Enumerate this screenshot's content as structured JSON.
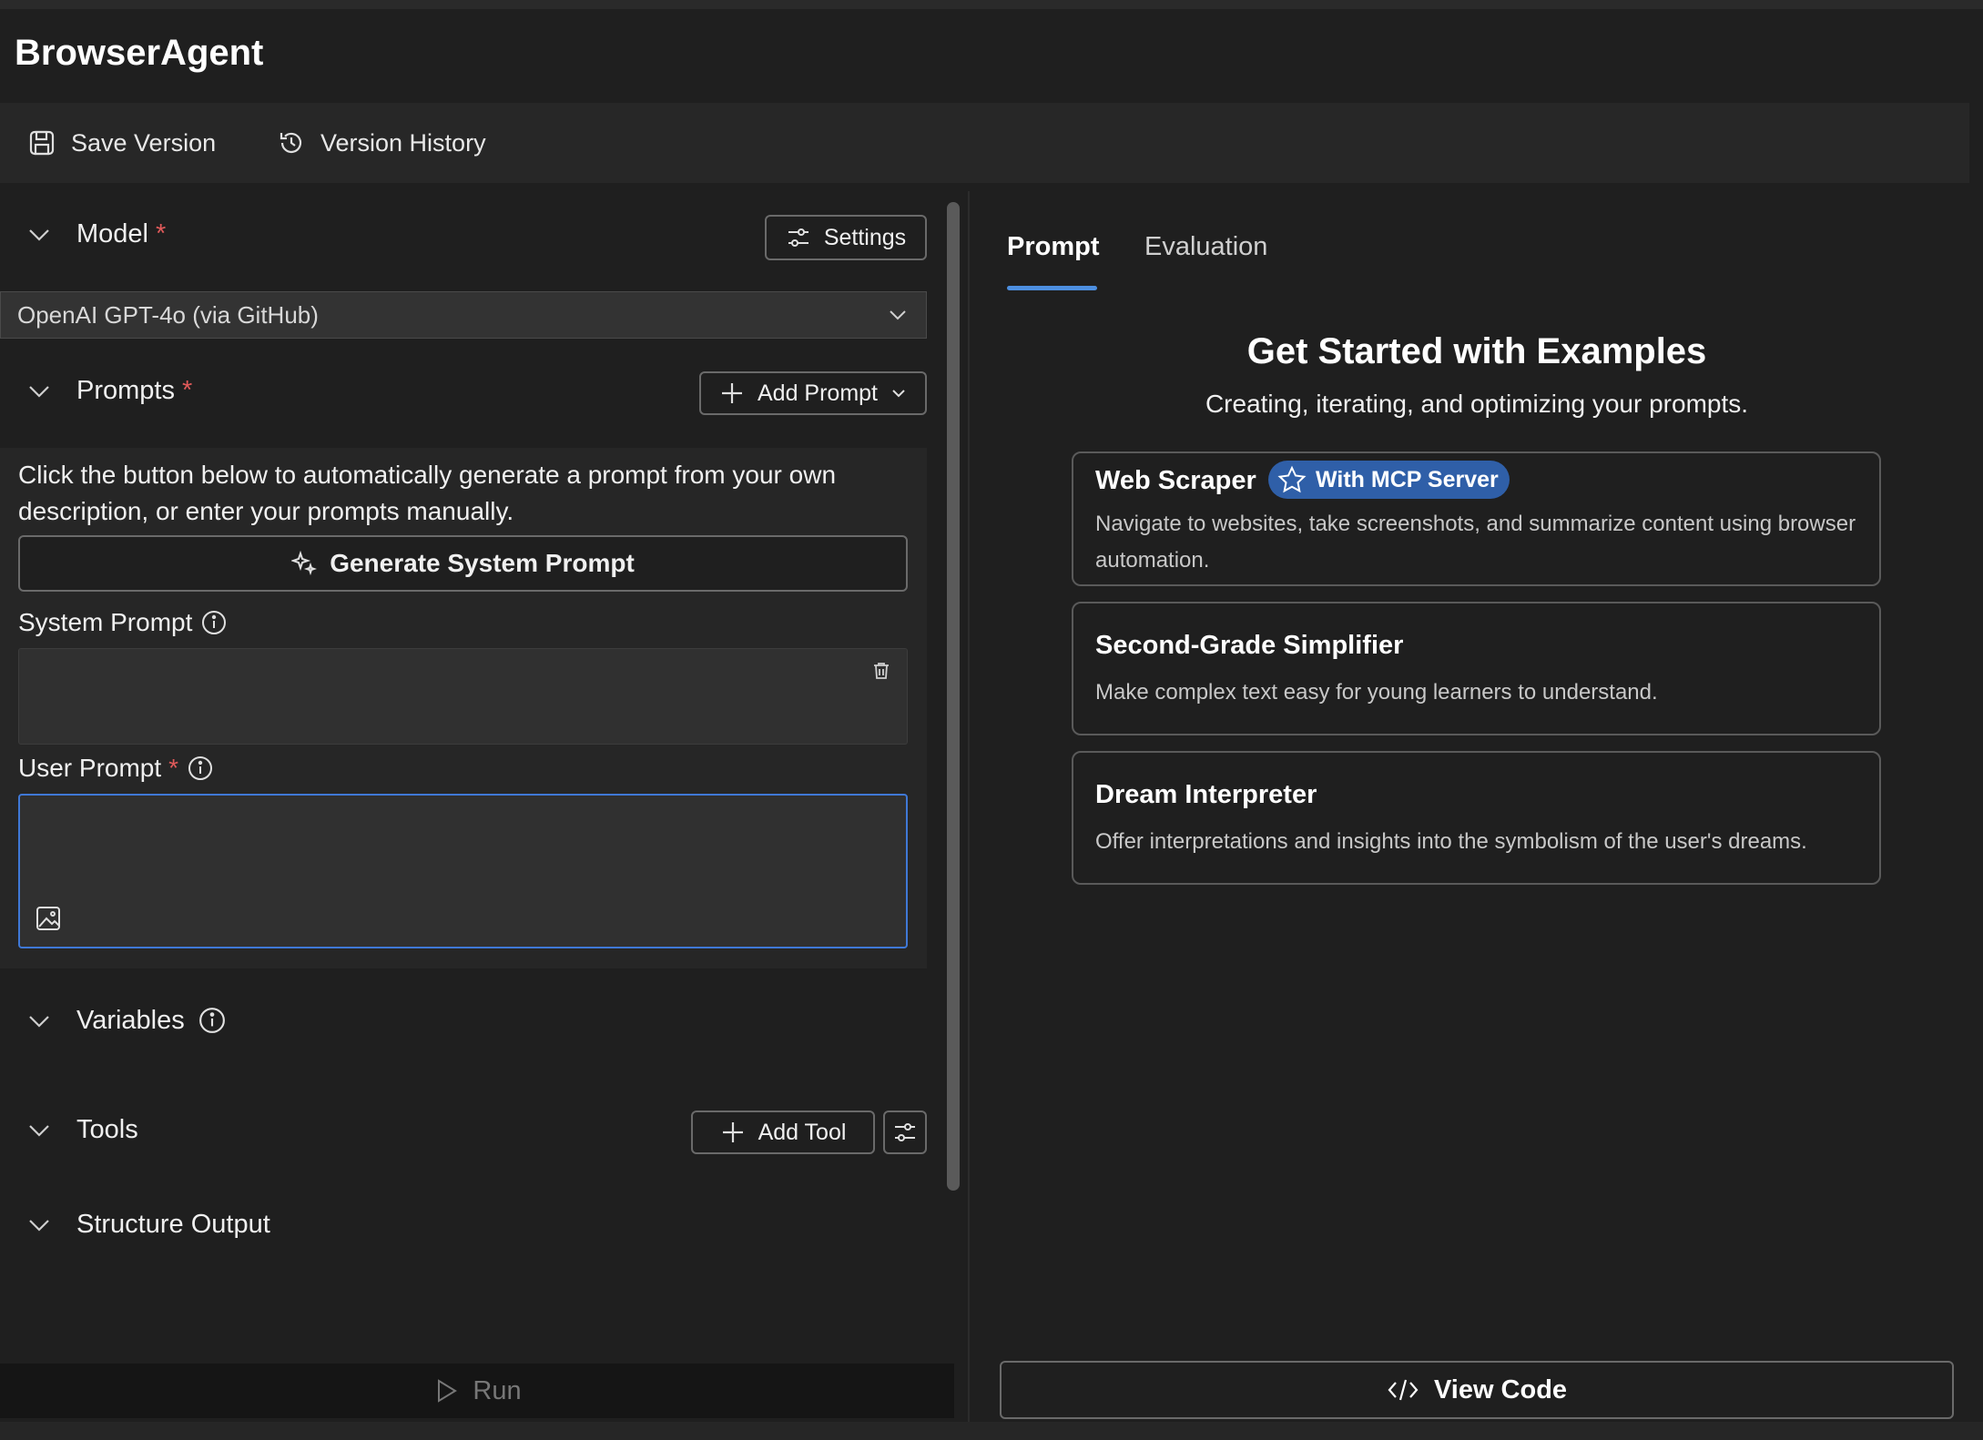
{
  "app": {
    "title": "BrowserAgent"
  },
  "toolbar": {
    "save_label": "Save Version",
    "history_label": "Version History"
  },
  "model": {
    "title": "Model",
    "required_mark": "*",
    "settings_label": "Settings",
    "selected": "OpenAI GPT-4o (via GitHub)"
  },
  "prompts": {
    "title": "Prompts",
    "required_mark": "*",
    "add_label": "Add Prompt",
    "description": "Click the button below to automatically generate a prompt from your own description, or enter your prompts manually.",
    "generate_label": "Generate System Prompt",
    "system_label": "System Prompt",
    "system_value": "",
    "user_label": "User Prompt",
    "user_required_mark": "*",
    "user_value": ""
  },
  "variables": {
    "title": "Variables"
  },
  "tools": {
    "title": "Tools",
    "add_label": "Add Tool"
  },
  "structure": {
    "title": "Structure Output"
  },
  "run": {
    "label": "Run"
  },
  "tabs": [
    {
      "label": "Prompt",
      "active": true
    },
    {
      "label": "Evaluation",
      "active": false
    }
  ],
  "examples": {
    "title": "Get Started with Examples",
    "subtitle": "Creating, iterating, and optimizing your prompts.",
    "cards": [
      {
        "title": "Web Scraper",
        "badge": "With MCP Server",
        "description": "Navigate to websites, take screenshots, and summarize content using browser automation."
      },
      {
        "title": "Second-Grade Simplifier",
        "description": "Make complex text easy for young learners to understand."
      },
      {
        "title": "Dream Interpreter",
        "description": "Offer interpretations and insights into the symbolism of the user's dreams."
      }
    ]
  },
  "view_code": {
    "label": "View Code"
  },
  "colors": {
    "accent": "#4d8fe0",
    "required": "#e05a5a",
    "badge": "#2f5fa8",
    "background": "#1f1f1f"
  }
}
